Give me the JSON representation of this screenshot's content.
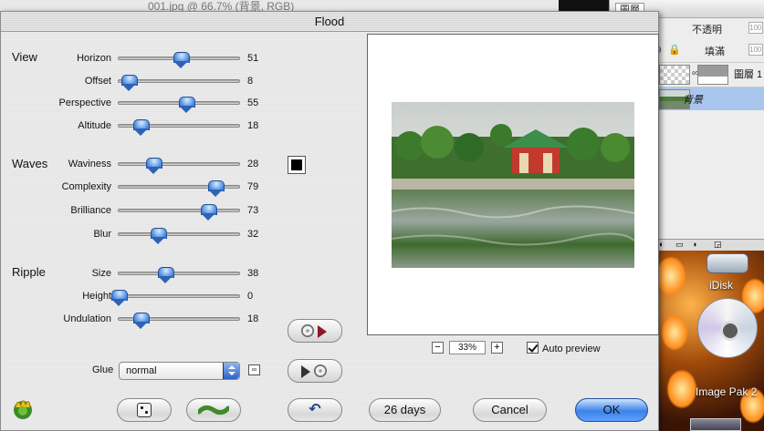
{
  "background": {
    "document_title": "001.jpg @ 66.7% (背景, RGB)"
  },
  "layers_panel": {
    "tab_label": "圖層",
    "opacity_label": "不透明",
    "opacity_value": "100",
    "fill_label": "填滿",
    "fill_value": "100",
    "layers": [
      {
        "name": "圖層 1",
        "selected": false
      },
      {
        "name": "背景",
        "selected": true
      }
    ]
  },
  "desktop": {
    "idisk_label": "iDisk",
    "cd_label": "Image Pak 2"
  },
  "dialog": {
    "title": "Flood",
    "sections": [
      {
        "name": "View",
        "params": [
          {
            "label": "Horizon",
            "value": 51
          },
          {
            "label": "Offset",
            "value": 8
          },
          {
            "label": "Perspective",
            "value": 55
          },
          {
            "label": "Altitude",
            "value": 18
          }
        ]
      },
      {
        "name": "Waves",
        "params": [
          {
            "label": "Waviness",
            "value": 28
          },
          {
            "label": "Complexity",
            "value": 79
          },
          {
            "label": "Brilliance",
            "value": 73
          },
          {
            "label": "Blur",
            "value": 32
          }
        ]
      },
      {
        "name": "Ripple",
        "params": [
          {
            "label": "Size",
            "value": 38
          },
          {
            "label": "Height",
            "value": 0
          },
          {
            "label": "Undulation",
            "value": 18
          }
        ]
      }
    ],
    "swatch_color": "#000000",
    "zoom": {
      "minus_label": "−",
      "value": "33%",
      "plus_label": "+"
    },
    "auto_preview": {
      "label": "Auto preview",
      "checked": true
    },
    "glue": {
      "label": "Glue",
      "value": "normal"
    },
    "buttons": {
      "days_label": "26 days",
      "cancel_label": "Cancel",
      "ok_label": "OK"
    },
    "accent_color": "#3b82e8"
  }
}
